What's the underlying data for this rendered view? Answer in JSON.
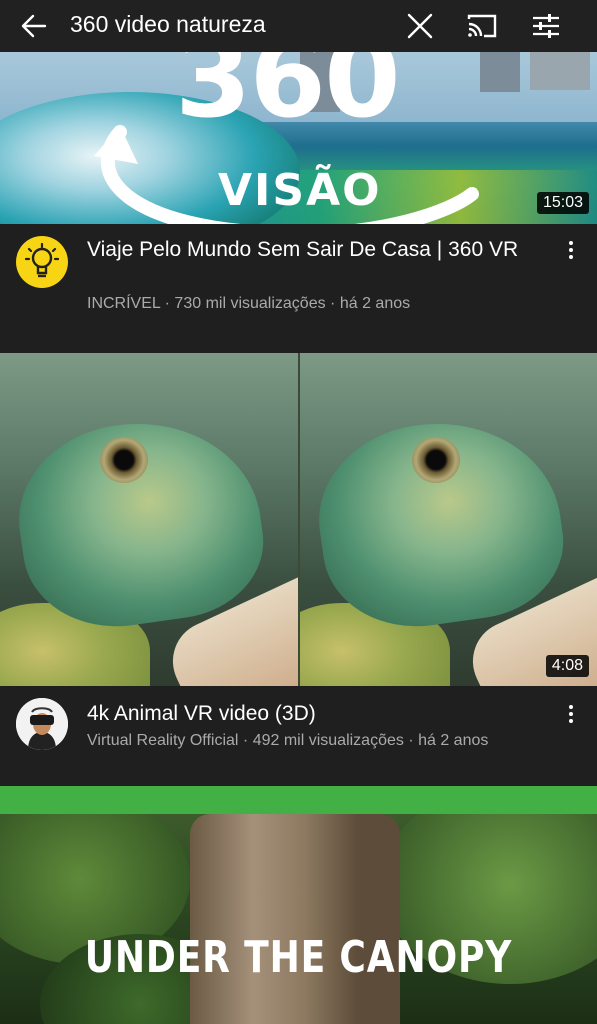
{
  "search": {
    "query": "360 video natureza",
    "back_icon": "arrow-left-icon",
    "clear_icon": "close-icon",
    "cast_icon": "cast-icon",
    "filter_icon": "filter-sliders-icon"
  },
  "results": [
    {
      "thumbnail_text": [
        "360",
        "VISÃO"
      ],
      "duration": "15:03",
      "title": "Viaje Pelo Mundo Sem Sair De Casa | 360 VR",
      "channel": "INCRÍVEL",
      "views": "730 mil visualizações",
      "age": "há 2 anos",
      "avatar_icon": "lightbulb-icon",
      "avatar_color": "#f7d515",
      "menu_icon": "more-vert-icon"
    },
    {
      "duration": "4:08",
      "title": "4k Animal VR video (3D)",
      "channel": "Virtual Reality Official",
      "views": "492 mil visualizações",
      "age": "há 2 anos",
      "avatar_icon": "vr-headset-person-icon",
      "menu_icon": "more-vert-icon"
    },
    {
      "thumbnail_text": "UNDER THE CANOPY",
      "banner_color": "#43b045"
    }
  ],
  "meta_separator": " · ",
  "colors": {
    "background": "#1f1f1f",
    "meta_text": "#aaaaaa",
    "title_text": "#ffffff"
  }
}
